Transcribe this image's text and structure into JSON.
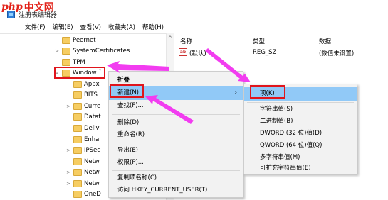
{
  "watermark": {
    "php": "php",
    "cn": "中文网"
  },
  "window": {
    "title": "注册表编辑器",
    "icon": "registry-icon"
  },
  "menubar": [
    "文件(F)",
    "编辑(E)",
    "查看(V)",
    "收藏夹(A)",
    "帮助(H)"
  ],
  "tree": {
    "items": [
      {
        "label": "Peernet",
        "expandable": false
      },
      {
        "label": "SystemCertificates",
        "expandable": true
      },
      {
        "label": "TPM",
        "expandable": false
      },
      {
        "label": "Window",
        "expandable": true,
        "expanded": true,
        "selected": true
      },
      {
        "label": "Appx",
        "expandable": false
      },
      {
        "label": "BITS",
        "expandable": false
      },
      {
        "label": "Curre",
        "expandable": true
      },
      {
        "label": "Datat",
        "expandable": false
      },
      {
        "label": "Deliv",
        "expandable": false
      },
      {
        "label": "Enha",
        "expandable": false
      },
      {
        "label": "IPSec",
        "expandable": true
      },
      {
        "label": "Netw",
        "expandable": false
      },
      {
        "label": "Netw",
        "expandable": true
      },
      {
        "label": "Netw",
        "expandable": true
      },
      {
        "label": "OneD",
        "expandable": false
      }
    ]
  },
  "values_pane": {
    "headers": {
      "name": "名称",
      "type": "类型",
      "data": "数据"
    },
    "rows": [
      {
        "name": "(默认)",
        "type": "REG_SZ",
        "data": "(数值未设置)"
      }
    ]
  },
  "context_menu": {
    "items": [
      "折叠",
      "新建(N)",
      "查找(F)...",
      "删除(D)",
      "重命名(R)",
      "导出(E)",
      "权限(P)...",
      "复制项名称(C)",
      "访问 HKEY_CURRENT_USER(T)"
    ],
    "submenu_arrow": "›"
  },
  "new_submenu": {
    "items": [
      "项(K)",
      "字符串值(S)",
      "二进制值(B)",
      "DWORD (32 位)值(D)",
      "QWORD (64 位)值(Q)",
      "多字符串值(M)",
      "可扩充字符串值(E)"
    ]
  },
  "colors": {
    "highlight": "#91c9f7",
    "annotation_red": "#e0151c",
    "arrow_magenta": "#f23cf0"
  }
}
